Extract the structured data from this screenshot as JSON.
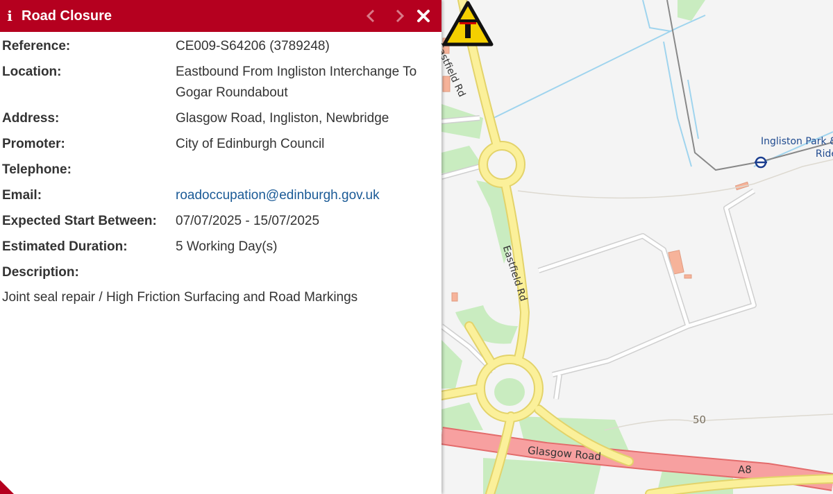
{
  "panel": {
    "icon": "info-icon",
    "title": "Road Closure",
    "accent_color": "#b5001f",
    "nav": {
      "prev_icon": "chevron-left-icon",
      "next_icon": "chevron-right-icon",
      "close_icon": "close-icon"
    }
  },
  "fields": [
    {
      "label": "Reference:",
      "value": "CE009-S64206 (3789248)"
    },
    {
      "label": "Location:",
      "value": "Eastbound From Ingliston Interchange To Gogar Roundabout"
    },
    {
      "label": "Address:",
      "value": "Glasgow Road, Ingliston, Newbridge"
    },
    {
      "label": "Promoter:",
      "value": "City of Edinburgh Council"
    },
    {
      "label": "Telephone:",
      "value": ""
    },
    {
      "label": "Email:",
      "value": "roadoccupation@edinburgh.gov.uk"
    },
    {
      "label": "Expected Start Between:",
      "value": "07/07/2025 - 15/07/2025"
    },
    {
      "label": "Estimated Duration:",
      "value": "5 Working Day(s)"
    },
    {
      "label": "Description:",
      "value": ""
    }
  ],
  "description": "Joint seal repair / High Friction Surfacing and Road Markings",
  "map": {
    "labels": {
      "eastfield_rd_north": "Eastfield Rd",
      "eastfield_rd_south": "Eastfield Rd",
      "glasgow_road": "Glasgow Road",
      "a8": "A8",
      "contour": "50",
      "station": "Ingliston Park & Ride"
    },
    "marker_icon": "roadworks-warning-icon",
    "station_icon": "tram-stop-icon"
  }
}
